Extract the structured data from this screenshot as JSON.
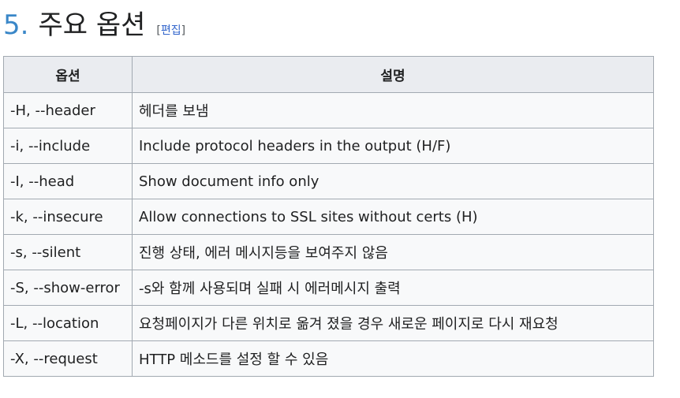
{
  "heading": {
    "number": "5.",
    "title": "주요 옵션",
    "edit_open": "[",
    "edit_label": "편집",
    "edit_close": "]"
  },
  "table": {
    "headers": [
      "옵션",
      "설명"
    ],
    "rows": [
      {
        "option": "-H, --header",
        "description": "헤더를 보냄"
      },
      {
        "option": "-i, --include",
        "description": "Include protocol headers in the output (H/F)"
      },
      {
        "option": "-I, --head",
        "description": "Show document info only"
      },
      {
        "option": "-k, --insecure",
        "description": "Allow connections to SSL sites without certs (H)"
      },
      {
        "option": "-s, --silent",
        "description": "진행 상태, 에러 메시지등을 보여주지 않음"
      },
      {
        "option": "-S, --show-error",
        "description": "-s와 함께 사용되며 실패 시 에러메시지 출력"
      },
      {
        "option": "-L, --location",
        "description": "요청페이지가 다른 위치로 옮겨 졌을 경우 새로운 페이지로 다시 재요청"
      },
      {
        "option": "-X, --request",
        "description": "HTTP 메소드를 설정 할 수 있음"
      }
    ]
  },
  "colors": {
    "section_number": "#3a87c8",
    "link": "#3366cc",
    "header_bg": "#eaecf0",
    "cell_bg": "#f8f9fa",
    "border": "#a2a9b1"
  }
}
